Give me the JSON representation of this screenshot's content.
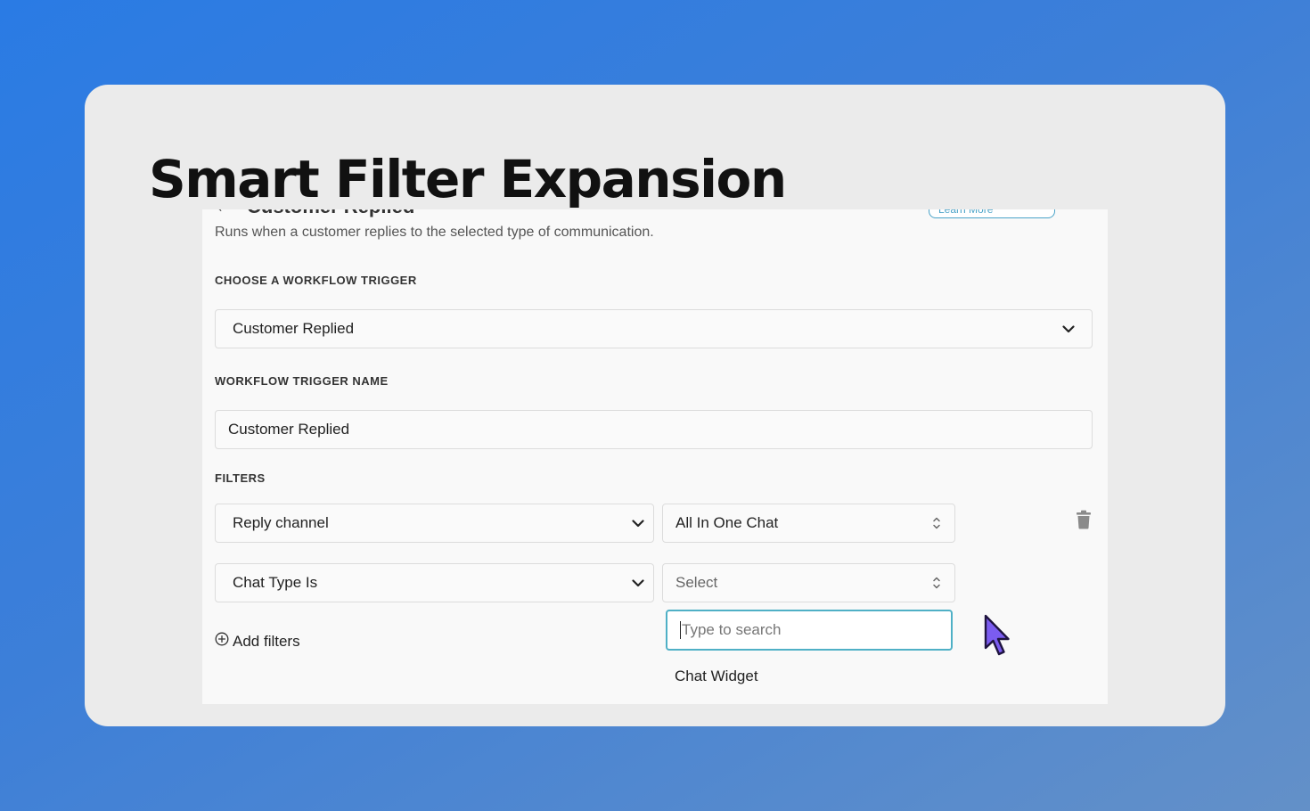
{
  "hero": {
    "title": "Smart Filter Expansion"
  },
  "panel_header": {
    "back_glyph": "←",
    "title": "Customer Replied",
    "learn_more": "Learn More",
    "close_glyph": "×",
    "subtitle": "Runs when a customer replies to the selected type of communication."
  },
  "trigger": {
    "label": "CHOOSE A WORKFLOW TRIGGER",
    "selected": "Customer Replied"
  },
  "trigger_name": {
    "label": "WORKFLOW TRIGGER NAME",
    "value": "Customer Replied"
  },
  "filters": {
    "label": "FILTERS",
    "rows": [
      {
        "field": "Reply channel",
        "value": "All In One Chat"
      },
      {
        "field": "Chat Type Is",
        "value": "Select"
      }
    ],
    "add_label": "Add filters"
  },
  "dropdown": {
    "search_placeholder": "Type to search",
    "options": [
      "Chat Widget"
    ]
  },
  "icons": {
    "delete": "trash-icon",
    "add": "plus-circle-icon",
    "chevron": "chevron-down-icon",
    "sort": "up-down-arrows-icon",
    "pointer": "mouse-pointer-icon"
  },
  "colors": {
    "background_start": "#2a7be4",
    "background_end": "#6390c8",
    "focus_ring": "#4fb0c6",
    "cursor_fill": "#7b5cf0"
  }
}
